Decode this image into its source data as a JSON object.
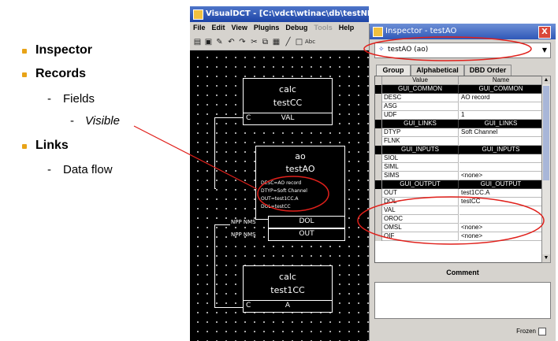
{
  "slide": {
    "bullets": {
      "inspector": "Inspector",
      "records": "Records",
      "fields": "Fields",
      "visible": "Visible",
      "links": "Links",
      "dataflow": "Data flow"
    },
    "dash": "-"
  },
  "vdct": {
    "title": "VisualDCT - [C:\\vdct\\wtinac\\db\\testNPD.vdb]",
    "menu": [
      "File",
      "Edit",
      "View",
      "Plugins",
      "Debug",
      "Tools",
      "Help"
    ],
    "records": {
      "calc1": {
        "type": "calc",
        "name": "testCC",
        "field": "VAL",
        "marker": "C"
      },
      "ao": {
        "type": "ao",
        "name": "testAO",
        "visible": [
          "DESC=AO record",
          "DTYP=Soft Channel",
          "OUT=test1CC.A",
          "DOL=testCC"
        ],
        "fields": [
          "DOL",
          "OUT"
        ],
        "link_labels": [
          "NPP NMS",
          "NPP NMS"
        ]
      },
      "calc2": {
        "type": "calc",
        "name": "test1CC",
        "field": "A",
        "marker": "C"
      }
    }
  },
  "inspector": {
    "title": "Inspector - testAO",
    "close": "X",
    "combo_value": "testAO (ao)",
    "tabs": [
      "Group",
      "Alphabetical",
      "DBD Order"
    ],
    "header": {
      "value": "Value",
      "name": "Name"
    },
    "rows": [
      {
        "hdr": true,
        "v": "GUI_COMMON",
        "n": "GUI_COMMON"
      },
      {
        "hdr": false,
        "v": "DESC",
        "n": "AO record"
      },
      {
        "hdr": false,
        "v": "ASG",
        "n": ""
      },
      {
        "hdr": false,
        "v": "UDF",
        "n": "1"
      },
      {
        "hdr": true,
        "v": "GUI_LINKS",
        "n": "GUI_LINKS"
      },
      {
        "hdr": false,
        "v": "DTYP",
        "n": "Soft Channel"
      },
      {
        "hdr": false,
        "v": "FLNK",
        "n": ""
      },
      {
        "hdr": true,
        "v": "GUI_INPUTS",
        "n": "GUI_INPUTS"
      },
      {
        "hdr": false,
        "v": "SIOL",
        "n": ""
      },
      {
        "hdr": false,
        "v": "SIML",
        "n": ""
      },
      {
        "hdr": false,
        "v": "SIMS",
        "n": "<none>"
      },
      {
        "hdr": true,
        "v": "GUI_OUTPUT",
        "n": "GUI_OUTPUT"
      },
      {
        "hdr": false,
        "v": "OUT",
        "n": "test1CC.A"
      },
      {
        "hdr": false,
        "v": "DOL",
        "n": "testCC"
      },
      {
        "hdr": false,
        "v": "VAL",
        "n": ""
      },
      {
        "hdr": false,
        "v": "OROC",
        "n": ""
      },
      {
        "hdr": false,
        "v": "OMSL",
        "n": "<none>"
      },
      {
        "hdr": false,
        "v": "OIF",
        "n": "<none>"
      }
    ],
    "comment_label": "Comment",
    "frozen_label": "Frozen"
  },
  "colors": {
    "bullet": "#e8a317",
    "callout": "#e0201b",
    "titlebar": "#1c43a6"
  }
}
